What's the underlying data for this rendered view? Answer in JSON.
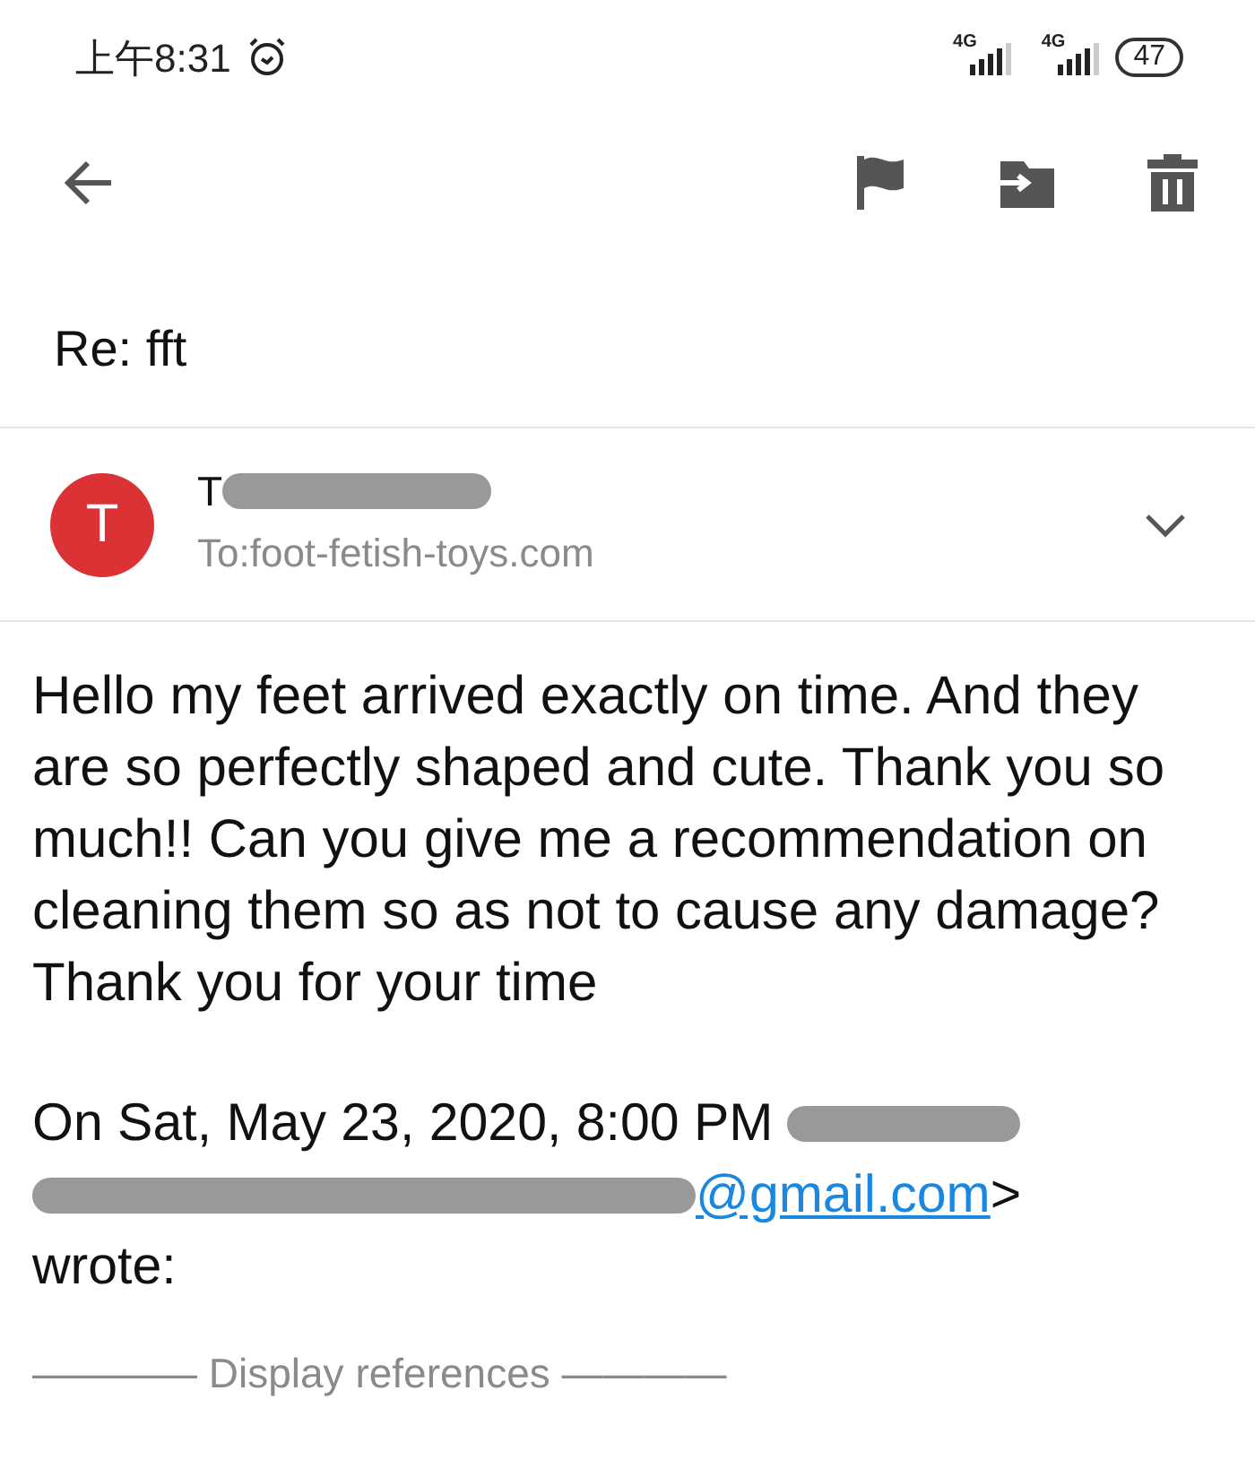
{
  "status_bar": {
    "time": "上午8:31",
    "network_1": "4G",
    "network_2": "4G",
    "battery": "47"
  },
  "subject": "Re: fft",
  "sender": {
    "avatar_letter": "T",
    "name": [
      {
        "kind": "text",
        "text": "T"
      },
      {
        "kind": "redacted"
      }
    ],
    "to": "To:foot-fetish-toys.com"
  },
  "body": "Hello my feet arrived exactly on time. And they are so perfectly shaped and cute. Thank you so much!!  Can you give me a recommendation on cleaning them so as not to cause any damage?  Thank you for your time",
  "quote": [
    [
      {
        "kind": "text",
        "text": "On Sat, May 23, 2020, 8:00 PM"
      },
      {
        "kind": "redacted"
      }
    ],
    [
      {
        "kind": "redacted"
      },
      {
        "kind": "link",
        "text": "@gmail.com"
      },
      {
        "kind": "text",
        "text": ">"
      }
    ],
    [
      {
        "kind": "text",
        "text": "wrote:"
      }
    ]
  ],
  "references": "———— Display references ————"
}
